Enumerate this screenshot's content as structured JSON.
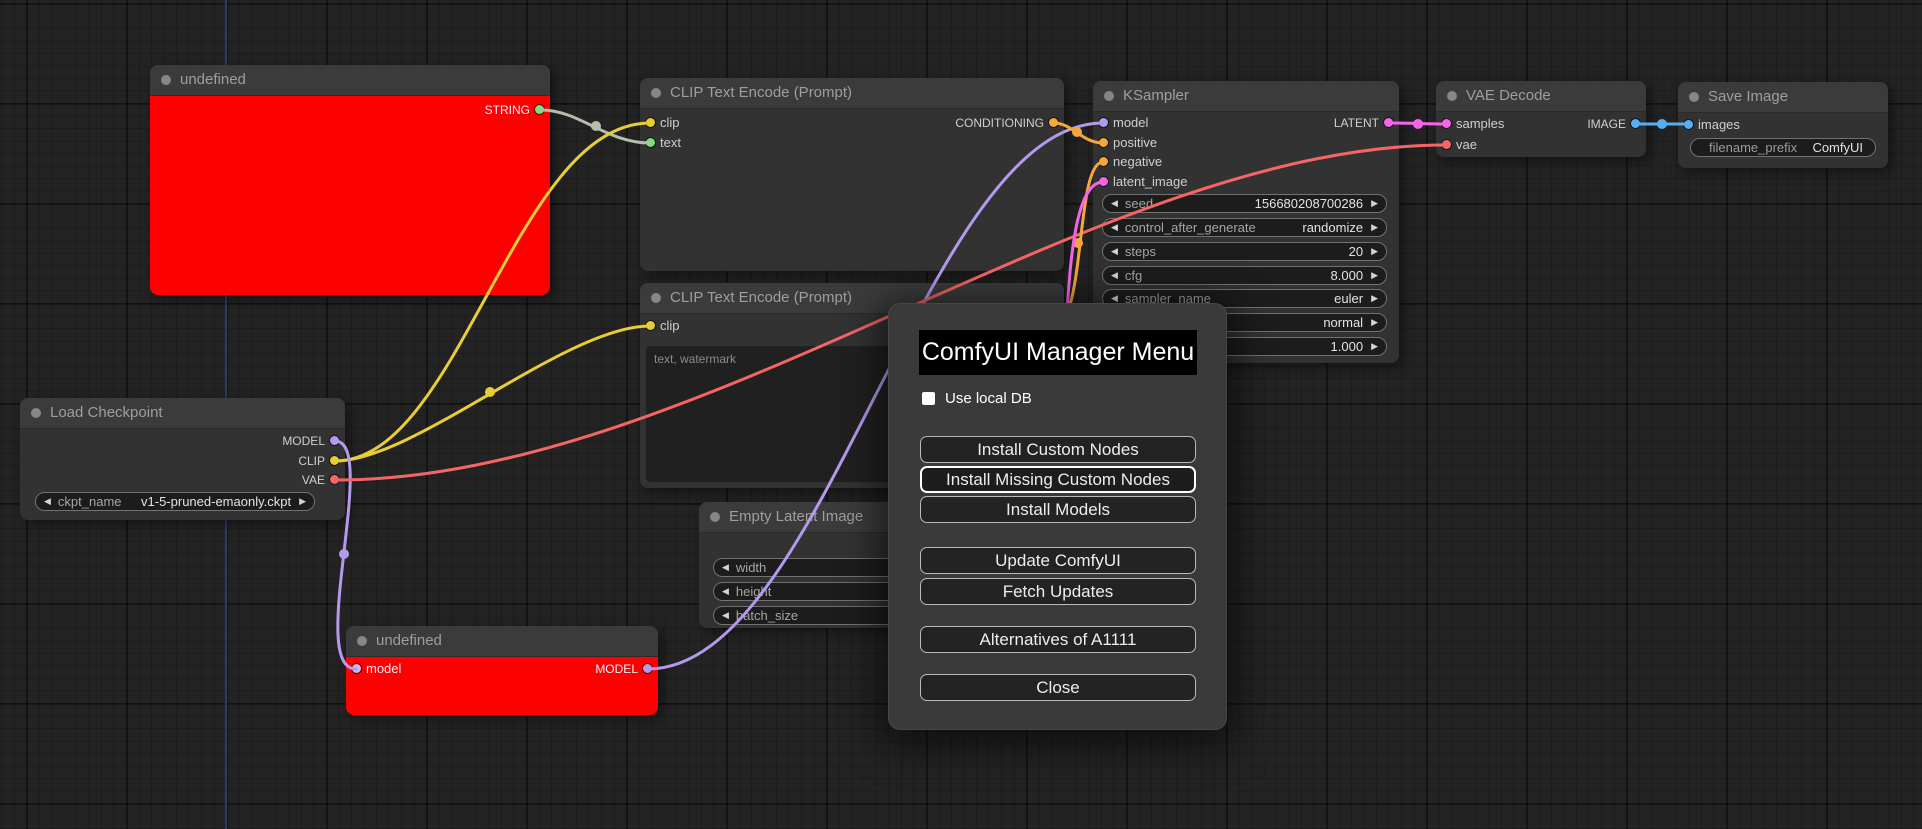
{
  "palette": {
    "yellow": "#e8cd37",
    "green": "#6fe66f",
    "purple": "#b49aed",
    "purple_light": "#cbb9f4",
    "orange": "#f5a73e",
    "pink": "#f565e8",
    "salmon": "#f56565",
    "blue": "#58aef2",
    "sage": "#b4bfaa",
    "node_red": "#fd0000",
    "guide_blue": "#2b3f66"
  },
  "icons": {
    "left_arrow": "◀",
    "right_arrow": "▶"
  },
  "nodes": {
    "undefined_top": {
      "title": "undefined",
      "output": "STRING"
    },
    "clip1": {
      "title": "CLIP Text Encode (Prompt)",
      "in_clip": "clip",
      "in_text": "text",
      "out": "CONDITIONING"
    },
    "clip2": {
      "title": "CLIP Text Encode (Prompt)",
      "in_clip": "clip",
      "text_value": "text, watermark"
    },
    "ksampler": {
      "title": "KSampler",
      "inputs": [
        "model",
        "positive",
        "negative",
        "latent_image"
      ],
      "output": "LATENT",
      "widgets": [
        {
          "label": "seed",
          "value": "156680208700286"
        },
        {
          "label": "control_after_generate",
          "value": "randomize"
        },
        {
          "label": "steps",
          "value": "20"
        },
        {
          "label": "cfg",
          "value": "8.000"
        },
        {
          "label": "sampler_name",
          "value": "euler"
        },
        {
          "label": "",
          "value": "normal"
        },
        {
          "label": "",
          "value": "1.000"
        }
      ]
    },
    "vae_decode": {
      "title": "VAE Decode",
      "in_samples": "samples",
      "in_vae": "vae",
      "output": "IMAGE"
    },
    "save_image": {
      "title": "Save Image",
      "input": "images",
      "widget": {
        "label": "filename_prefix",
        "value": "ComfyUI"
      }
    },
    "checkpoint": {
      "title": "Load Checkpoint",
      "outputs": [
        "MODEL",
        "CLIP",
        "VAE"
      ],
      "widget": {
        "label": "ckpt_name",
        "value": "v1-5-pruned-emaonly.ckpt"
      }
    },
    "empty_latent": {
      "title": "Empty Latent Image",
      "widgets": [
        {
          "label": "width",
          "value": ""
        },
        {
          "label": "height",
          "value": ""
        },
        {
          "label": "batch_size",
          "value": ""
        }
      ]
    },
    "undefined_bottom": {
      "title": "undefined",
      "input": "model",
      "output": "MODEL"
    }
  },
  "dialog": {
    "title": "ComfyUI Manager Menu",
    "checkbox_label": "Use local DB",
    "checkbox_checked": false,
    "buttons": [
      "Install Custom Nodes",
      "Install Missing Custom Nodes",
      "Install Models",
      "Update ComfyUI",
      "Fetch Updates",
      "Alternatives of A1111",
      "Close"
    ]
  },
  "links": [
    {
      "from": "undefined.STRING",
      "to": "CLIP Text Encode (Prompt).text",
      "color": "sage"
    },
    {
      "from": "Load Checkpoint.CLIP",
      "to": "CLIP Text Encode (Prompt) 1.clip",
      "color": "yellow"
    },
    {
      "from": "Load Checkpoint.CLIP",
      "to": "CLIP Text Encode (Prompt) 2.clip",
      "color": "yellow"
    },
    {
      "from": "Load Checkpoint.MODEL",
      "to": "undefined.model",
      "color": "purple"
    },
    {
      "from": "undefined.MODEL",
      "to": "KSampler.model",
      "color": "purple"
    },
    {
      "from": "Load Checkpoint.VAE",
      "to": "VAE Decode.vae",
      "color": "salmon"
    },
    {
      "from": "CLIP Text Encode (Prompt) 1.CONDITIONING",
      "to": "KSampler.positive",
      "color": "orange"
    },
    {
      "from": "CLIP Text Encode (Prompt) 2.CONDITIONING",
      "to": "KSampler.negative",
      "color": "orange"
    },
    {
      "from": "Empty Latent Image.LATENT",
      "to": "KSampler.latent_image",
      "color": "pink"
    },
    {
      "from": "KSampler.LATENT",
      "to": "VAE Decode.samples",
      "color": "pink"
    },
    {
      "from": "VAE Decode.IMAGE",
      "to": "Save Image.images",
      "color": "blue"
    }
  ]
}
